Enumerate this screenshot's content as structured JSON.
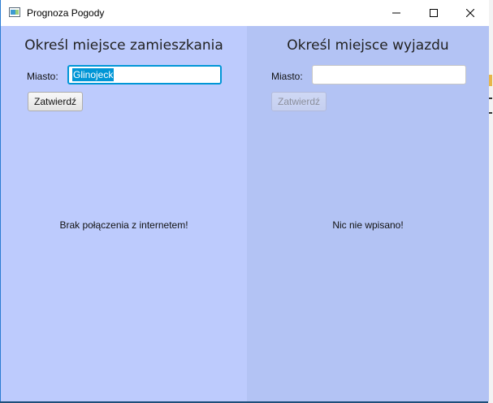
{
  "window": {
    "title": "Prognoza Pogody",
    "controls": {
      "minimize": "minimize",
      "maximize": "maximize",
      "close": "close"
    }
  },
  "left_pane": {
    "heading": "Określ miejsce zamieszkania",
    "city_label": "Miasto:",
    "city_value": "Glinojeck",
    "submit_label": "Zatwierdź",
    "message": "Brak połączenia z internetem!"
  },
  "right_pane": {
    "heading": "Określ miejsce wyjazdu",
    "city_label": "Miasto:",
    "city_value": "",
    "submit_label": "Zatwierdź",
    "message": "Nic nie wpisano!"
  },
  "colors": {
    "left_pane_bg": "#bdcbfd",
    "right_pane_bg": "#b3c3f4",
    "focus_accent": "#0096d6"
  }
}
